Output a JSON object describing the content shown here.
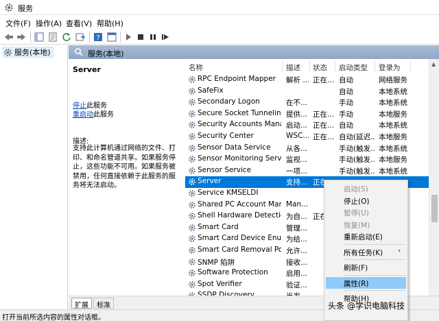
{
  "window": {
    "title": "服务"
  },
  "menu": [
    "文件(F)",
    "操作(A)",
    "查看(V)",
    "帮助(H)"
  ],
  "toolbar": {
    "icons": [
      "back-icon",
      "forward-icon",
      "show-tree-icon",
      "properties-icon",
      "refresh-icon",
      "export-icon",
      "help-icon",
      "console-icon",
      "start-icon",
      "stop-icon",
      "pause-icon",
      "restart-icon"
    ]
  },
  "tree": {
    "root_label": "服务(本地)"
  },
  "header": {
    "title": "服务(本地)"
  },
  "description": {
    "service_name": "Server",
    "stop_link": "停止",
    "stop_rest": "此服务",
    "restart_link": "重启动",
    "restart_rest": "此服务",
    "label": "描述:",
    "text": "支持此计算机通过网络的文件、打印、和命名管道共享。如果服务停止，这些功能不可用。如果服务被禁用，任何直接依赖于此服务的服务将无法启动。"
  },
  "columns": [
    "名称",
    "描述",
    "状态",
    "启动类型",
    "登录为"
  ],
  "rows": [
    {
      "name": "RPC Endpoint Mapper",
      "desc": "解析 ...",
      "status": "正在...",
      "startup": "自动",
      "logon": "网络服务"
    },
    {
      "name": "SafeFix",
      "desc": "",
      "status": "",
      "startup": "自动",
      "logon": "本地系统"
    },
    {
      "name": "Secondary Logon",
      "desc": "在不...",
      "status": "",
      "startup": "手动",
      "logon": "本地系统"
    },
    {
      "name": "Secure Socket Tunneling ...",
      "desc": "提供...",
      "status": "正在...",
      "startup": "手动",
      "logon": "本地服务"
    },
    {
      "name": "Security Accounts Manag...",
      "desc": "启动...",
      "status": "正在...",
      "startup": "自动",
      "logon": "本地系统"
    },
    {
      "name": "Security Center",
      "desc": "WSC...",
      "status": "正在...",
      "startup": "自动(延迟...",
      "logon": "本地服务"
    },
    {
      "name": "Sensor Data Service",
      "desc": "从各...",
      "status": "",
      "startup": "手动(触发...",
      "logon": "本地系统"
    },
    {
      "name": "Sensor Monitoring Service",
      "desc": "监视...",
      "status": "",
      "startup": "手动(触发...",
      "logon": "本地服务"
    },
    {
      "name": "Sensor Service",
      "desc": "一项...",
      "status": "",
      "startup": "手动(触发...",
      "logon": "本地系统"
    },
    {
      "name": "Server",
      "desc": "支持...",
      "status": "正在",
      "startup": "",
      "logon": "",
      "selected": true
    },
    {
      "name": "Service KMSELDI",
      "desc": "",
      "status": "",
      "startup": "",
      "logon": ""
    },
    {
      "name": "Shared PC Account Mana...",
      "desc": "Man...",
      "status": "",
      "startup": "",
      "logon": ""
    },
    {
      "name": "Shell Hardware Detection",
      "desc": "为自...",
      "status": "正在",
      "startup": "",
      "logon": ""
    },
    {
      "name": "Smart Card",
      "desc": "管理...",
      "status": "",
      "startup": "",
      "logon": ""
    },
    {
      "name": "Smart Card Device Enum...",
      "desc": "为给...",
      "status": "",
      "startup": "",
      "logon": ""
    },
    {
      "name": "Smart Card Removal Poli...",
      "desc": "允许...",
      "status": "",
      "startup": "",
      "logon": ""
    },
    {
      "name": "SNMP 陷阱",
      "desc": "接收...",
      "status": "",
      "startup": "",
      "logon": ""
    },
    {
      "name": "Software Protection",
      "desc": "启用...",
      "status": "",
      "startup": "",
      "logon": ""
    },
    {
      "name": "Spot Verifier",
      "desc": "验证...",
      "status": "",
      "startup": "",
      "logon": ""
    },
    {
      "name": "SSDP Discovery",
      "desc": "当发...",
      "status": "",
      "startup": "",
      "logon": ""
    }
  ],
  "context_menu": {
    "items": [
      {
        "label": "启动(S)",
        "disabled": true
      },
      {
        "label": "停止(O)"
      },
      {
        "label": "暂停(U)",
        "disabled": true
      },
      {
        "label": "恢复(M)",
        "disabled": true
      },
      {
        "label": "重新启动(E)"
      },
      {
        "sep": true
      },
      {
        "label": "所有任务(K)",
        "submenu": true
      },
      {
        "sep": true
      },
      {
        "label": "刷新(F)"
      },
      {
        "sep": true
      },
      {
        "label": "属性(R)",
        "hover": true
      },
      {
        "sep": true
      },
      {
        "label": "帮助(H)"
      }
    ]
  },
  "tabs": [
    "扩展",
    "标准"
  ],
  "status": {
    "text": "打开当前所选内容的属性对话框。"
  },
  "watermark": {
    "prefix": "头条",
    "text": "@学识电脑科技"
  },
  "colors": {
    "selection": "#0078d7",
    "hover": "#91c9f7",
    "header": "#8ea6c6"
  }
}
